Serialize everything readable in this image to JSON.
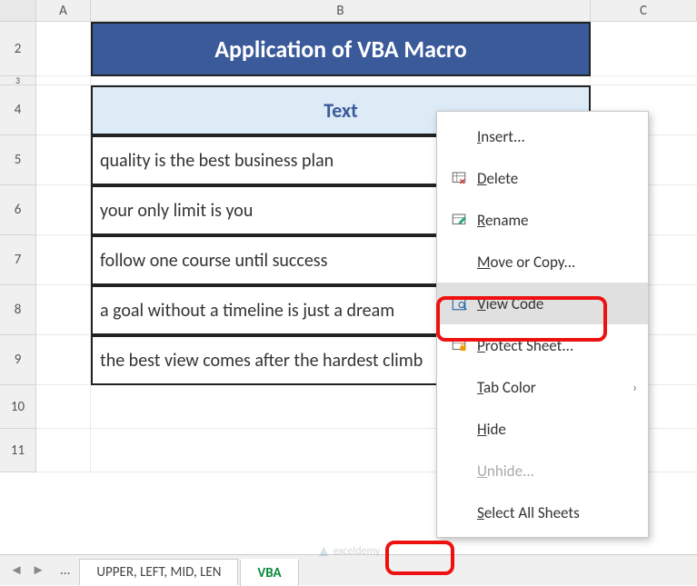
{
  "columns": {
    "A": "A",
    "B": "B",
    "C": "C"
  },
  "rows": {
    "r2": "2",
    "r3": "3",
    "r4": "4",
    "r5": "5",
    "r6": "6",
    "r7": "7",
    "r8": "8",
    "r9": "9",
    "r10": "10",
    "r11": "11"
  },
  "title": "Application of VBA Macro",
  "table": {
    "header": "Text",
    "data": [
      "quality is the best business plan",
      "your only limit is you",
      "follow one course until success",
      "a goal without a timeline is just a dream",
      "the best view comes after the hardest climb"
    ]
  },
  "context_menu": {
    "items": [
      {
        "label": "Insert...",
        "accel": "I",
        "icon": ""
      },
      {
        "label": "Delete",
        "accel": "D",
        "icon": "delete"
      },
      {
        "label": "Rename",
        "accel": "R",
        "icon": "rename"
      },
      {
        "label": "Move or Copy...",
        "accel": "M",
        "icon": ""
      },
      {
        "label": "View Code",
        "accel": "V",
        "icon": "viewcode",
        "hover": true
      },
      {
        "label": "Protect Sheet...",
        "accel": "P",
        "icon": "protect"
      },
      {
        "label": "Tab Color",
        "accel": "T",
        "icon": "",
        "submenu": true
      },
      {
        "label": "Hide",
        "accel": "H",
        "icon": ""
      },
      {
        "label": "Unhide...",
        "accel": "U",
        "icon": "",
        "disabled": true
      },
      {
        "label": "Select All Sheets",
        "accel": "S",
        "icon": ""
      }
    ]
  },
  "sheet_tabs": {
    "tab1": "UPPER, LEFT, MID, LEN",
    "tab2": "VBA"
  },
  "watermark": "exceldemy"
}
